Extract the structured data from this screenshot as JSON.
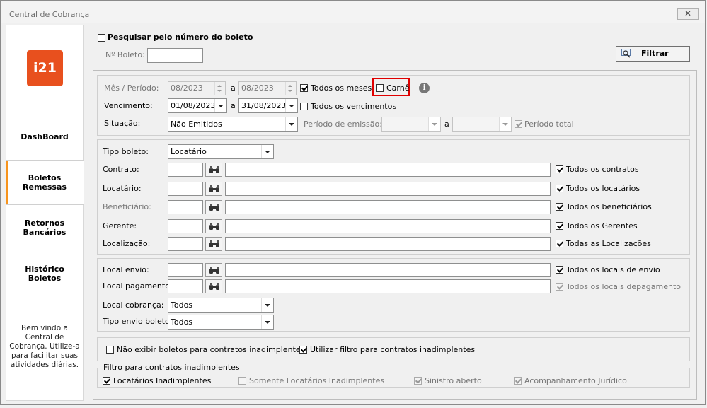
{
  "window": {
    "title": "Central de Cobrança",
    "close_glyph": "✕"
  },
  "sidebar": {
    "logo_text": "i21",
    "items": [
      {
        "label": "DashBoard"
      },
      {
        "label": "Boletos\nRemessas"
      },
      {
        "label": "Retornos\nBancários"
      },
      {
        "label": "Histórico\nBoletos"
      }
    ],
    "welcome": "Bem vindo a Central de Cobrança. Utilize-a para facilitar suas atividades diárias."
  },
  "search": {
    "checkbox_label": "Pesquisar pelo número do boleto",
    "numero_label": "Nº Boleto:",
    "numero_value": "",
    "filtrar_label": "Filtrar"
  },
  "periodo": {
    "mes_label": "Mês / Período:",
    "mes_from": "08/2023",
    "a1": "a",
    "mes_to": "08/2023",
    "todos_meses": "Todos os meses",
    "carne": "Carnê",
    "info_glyph": "i",
    "vencimento_label": "Vencimento:",
    "venc_from": "01/08/2023",
    "a2": "a",
    "venc_to": "31/08/2023",
    "todos_vencimentos": "Todos os vencimentos",
    "situacao_label": "Situação:",
    "situacao_value": "Não Emitidos",
    "periodo_emissao_label": "Período de emissão:",
    "a3": "a",
    "periodo_total": "Período total"
  },
  "filters": {
    "tipo_boleto_label": "Tipo boleto:",
    "tipo_boleto_value": "Locatário",
    "rows": [
      {
        "label": "Contrato:",
        "check": "Todos os contratos"
      },
      {
        "label": "Locatário:",
        "check": "Todos os locatários"
      },
      {
        "label": "Beneficiário:",
        "check": "Todos os beneficiários"
      },
      {
        "label": "Gerente:",
        "check": "Todos os Gerentes"
      },
      {
        "label": "Localização:",
        "check": "Todas as Localizações"
      }
    ]
  },
  "locais": {
    "envio_label": "Local envio:",
    "envio_check": "Todos os locais de envio",
    "pagamento_label": "Local pagamento:",
    "pagamento_check": "Todos os locais depagamento",
    "cobranca_label": "Local cobrança:",
    "cobranca_value": "Todos",
    "tipo_envio_label": "Tipo envio boleto:",
    "tipo_envio_value": "Todos"
  },
  "inadimplentes": {
    "nao_exibir": "Não exibir boletos para contratos inadimplentes",
    "utilizar": "Utilizar filtro para contratos inadimplentes",
    "group_title": "Filtro para contratos inadimplentes",
    "locatarios": "Locatários Inadimplentes",
    "somente": "Somente Locatários Inadimplentes",
    "sinistro": "Sinistro aberto",
    "acompanhamento": "Acompanhamento Jurídico"
  },
  "icons": {
    "binoculars": "binoculars-icon",
    "filter": "search-filter-icon",
    "info": "info-icon"
  },
  "colors": {
    "logo": "#e8501e",
    "active_accent": "#f7941d",
    "highlight": "#e00000"
  }
}
